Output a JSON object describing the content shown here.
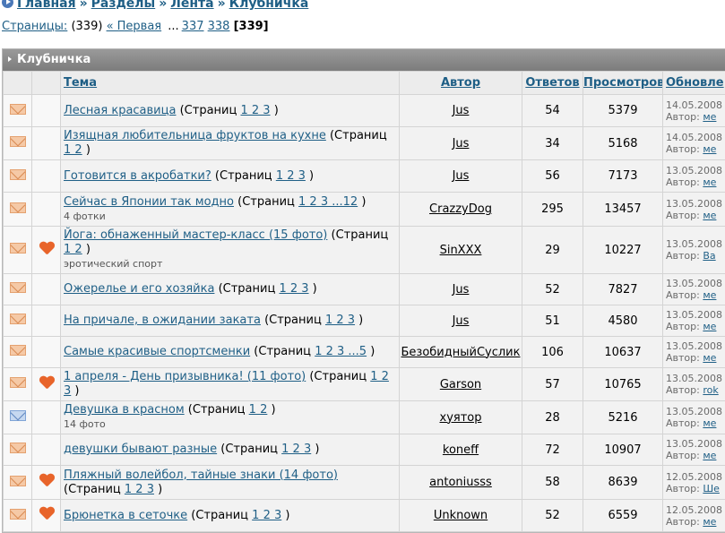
{
  "breadcrumb": {
    "items": [
      "Главная",
      "Разделы",
      "Лента",
      "Клубничка"
    ],
    "separator": "»"
  },
  "pagination": {
    "label": "Страницы:",
    "total": "(339)",
    "first": "« Первая",
    "ellipsis": "...",
    "links": [
      "337",
      "338"
    ],
    "current": "[339]"
  },
  "forum": {
    "title": "Клубничка",
    "columns": {
      "topic": "Тема",
      "author": "Автор",
      "replies": "Ответов",
      "views": "Просмотров",
      "updated": "Обновле"
    },
    "pages_label": "(Страниц",
    "rows": [
      {
        "icon": "envelope-icon",
        "hot": false,
        "title": "Лесная красавица",
        "pages": "1 2 3",
        "sub": "",
        "author": "Jus",
        "replies": "54",
        "views": "5379",
        "date": "14.05.2008",
        "by": "Автор:",
        "by_user": "ме"
      },
      {
        "icon": "envelope-icon",
        "hot": false,
        "title": "Изящная любительница фруктов на кухне",
        "pages": "1 2",
        "sub": "",
        "author": "Jus",
        "replies": "34",
        "views": "5168",
        "date": "14.05.2008",
        "by": "Автор:",
        "by_user": "ме"
      },
      {
        "icon": "envelope-icon",
        "hot": false,
        "title": "Готовится в акробатки?",
        "pages": "1 2 3",
        "sub": "",
        "author": "Jus",
        "replies": "56",
        "views": "7173",
        "date": "13.05.2008",
        "by": "Автор:",
        "by_user": "ме"
      },
      {
        "icon": "envelope-icon",
        "hot": false,
        "title": "Сейчас в Японии так модно",
        "pages": "1 2 3 ...12",
        "sub": "4 фотки",
        "author": "CrazzyDog",
        "replies": "295",
        "views": "13457",
        "date": "13.05.2008",
        "by": "Автор:",
        "by_user": "ме"
      },
      {
        "icon": "envelope-icon",
        "hot": true,
        "title": "Йога: обнаженный мастер-класс (15 фото)",
        "pages": "1 2",
        "sub": "эротический спорт",
        "author": "SinXXX",
        "replies": "29",
        "views": "10227",
        "date": "13.05.2008",
        "by": "Автор:",
        "by_user": "Ва"
      },
      {
        "icon": "envelope-icon",
        "hot": false,
        "title": "Ожерелье и его хозяйка",
        "pages": "1 2 3",
        "sub": "",
        "author": "Jus",
        "replies": "52",
        "views": "7827",
        "date": "13.05.2008",
        "by": "Автор:",
        "by_user": "ме"
      },
      {
        "icon": "envelope-icon",
        "hot": false,
        "title": "На причале, в ожидании заката",
        "pages": "1 2 3",
        "sub": "",
        "author": "Jus",
        "replies": "51",
        "views": "4580",
        "date": "13.05.2008",
        "by": "Автор:",
        "by_user": "ме"
      },
      {
        "icon": "envelope-icon",
        "hot": false,
        "title": "Самые красивые спортсменки",
        "pages": "1 2 3 ...5",
        "sub": "",
        "author": "БезобидныйСуслик",
        "replies": "106",
        "views": "10637",
        "date": "13.05.2008",
        "by": "Автор:",
        "by_user": "ме"
      },
      {
        "icon": "envelope-icon",
        "hot": true,
        "title": "1 апреля - День призывника! (11 фото)",
        "pages": "1 2 3",
        "sub": "",
        "author": "Garson",
        "replies": "57",
        "views": "10765",
        "date": "13.05.2008",
        "by": "Автор:",
        "by_user": "rok"
      },
      {
        "icon": "envelope-blue-icon",
        "hot": false,
        "title": "Девушка в красном",
        "pages": "1 2",
        "sub": "14 фото",
        "author": "хуятор",
        "replies": "28",
        "views": "5216",
        "date": "13.05.2008",
        "by": "Автор:",
        "by_user": "ме"
      },
      {
        "icon": "envelope-icon",
        "hot": false,
        "title": "девушки бывают разные",
        "pages": "1 2 3",
        "sub": "",
        "author": "koneff",
        "replies": "72",
        "views": "10907",
        "date": "13.05.2008",
        "by": "Автор:",
        "by_user": "ме"
      },
      {
        "icon": "envelope-icon",
        "hot": true,
        "title": "Пляжный волейбол, тайные знаки (14 фото)",
        "pages": "1 2 3",
        "sub": "",
        "author": "antoniusss",
        "replies": "58",
        "views": "8639",
        "date": "12.05.2008",
        "by": "Автор:",
        "by_user": "Ше"
      },
      {
        "icon": "envelope-icon",
        "hot": true,
        "title": "Брюнетка в сеточке",
        "pages": "1 2 3",
        "sub": "",
        "author": "Unknown",
        "replies": "52",
        "views": "6559",
        "date": "12.05.2008",
        "by": "Автор:",
        "by_user": "ме"
      }
    ]
  }
}
